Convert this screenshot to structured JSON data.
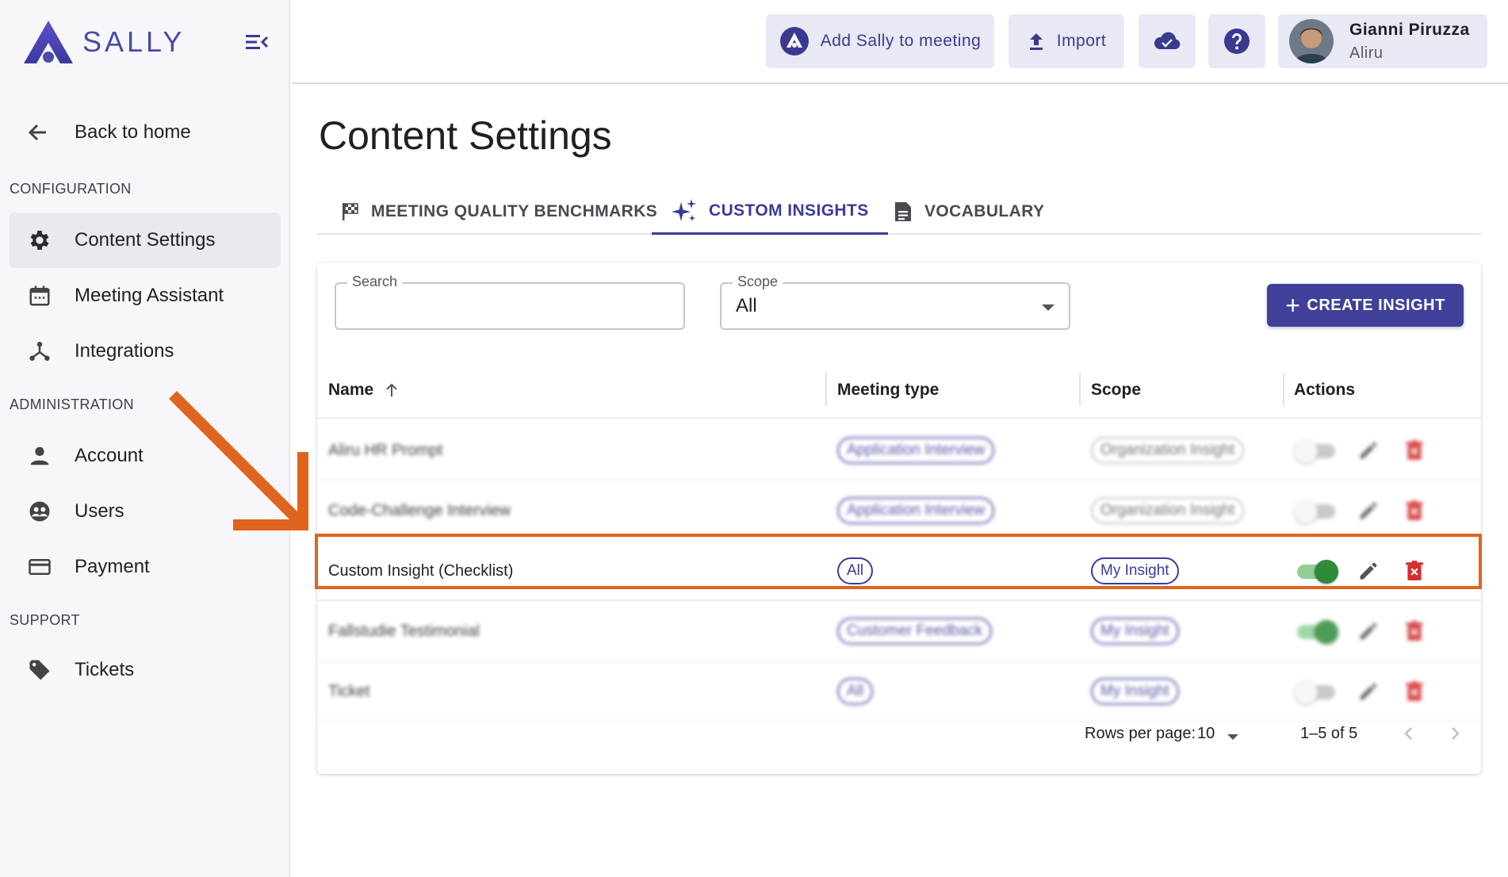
{
  "brand": {
    "name": "SALLY",
    "color": "#4a4aa8"
  },
  "sidebar": {
    "back_label": "Back to home",
    "sections": {
      "configuration": "CONFIGURATION",
      "administration": "ADMINISTRATION",
      "support": "SUPPORT"
    },
    "items": [
      {
        "label": "Content Settings",
        "icon": "gear-icon",
        "active": true
      },
      {
        "label": "Meeting Assistant",
        "icon": "calendar-icon"
      },
      {
        "label": "Integrations",
        "icon": "integrations-icon"
      },
      {
        "label": "Account",
        "icon": "person-icon"
      },
      {
        "label": "Users",
        "icon": "users-icon"
      },
      {
        "label": "Payment",
        "icon": "credit-card-icon"
      },
      {
        "label": "Tickets",
        "icon": "tag-icon"
      }
    ]
  },
  "header": {
    "add_sally_label": "Add Sally to meeting",
    "import_label": "Import",
    "user": {
      "name": "Gianni Piruzza",
      "org": "Aliru"
    }
  },
  "page": {
    "title": "Content Settings",
    "tabs": [
      {
        "label": "MEETING QUALITY BENCHMARKS",
        "icon": "flag-icon"
      },
      {
        "label": "CUSTOM INSIGHTS",
        "icon": "sparkle-icon",
        "active": true
      },
      {
        "label": "VOCABULARY",
        "icon": "document-icon"
      }
    ]
  },
  "filters": {
    "search_label": "Search",
    "search_value": "",
    "scope_label": "Scope",
    "scope_value": "All",
    "create_label": "CREATE INSIGHT"
  },
  "table": {
    "columns": [
      "Name",
      "Meeting type",
      "Scope",
      "Actions"
    ],
    "rows": [
      {
        "name": "Aliru HR Prompt",
        "meeting_type": "Application Interview",
        "scope": "Organization Insight",
        "enabled": false,
        "blurred": true
      },
      {
        "name": "Code-Challenge Interview",
        "meeting_type": "Application Interview",
        "scope": "Organization Insight",
        "enabled": false,
        "blurred": true
      },
      {
        "name": "Custom Insight (Checklist)",
        "meeting_type": "All",
        "scope": "My Insight",
        "enabled": true,
        "blurred": false
      },
      {
        "name": "Fallstudie Testimonial",
        "meeting_type": "Customer Feedback",
        "scope": "My Insight",
        "enabled": true,
        "blurred": true
      },
      {
        "name": "Ticket",
        "meeting_type": "All",
        "scope": "My Insight",
        "enabled": false,
        "blurred": true
      }
    ]
  },
  "pagination": {
    "rows_per_page_label": "Rows per page:",
    "rows_per_page": "10",
    "range": "1–5 of 5"
  },
  "colors": {
    "accent": "#3b3b9a",
    "highlight": "#e0641e",
    "toggle_on": "#2e8b3a",
    "delete": "#d32f2f"
  }
}
